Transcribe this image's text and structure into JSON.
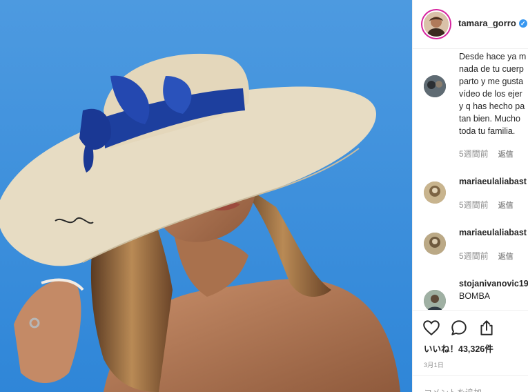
{
  "post": {
    "username": "tamara_gorro",
    "verified_icon": "verified-check-icon",
    "likes_text": "いいね！43,326件",
    "date": "3月1日",
    "add_comment_placeholder": "コメントを追加..."
  },
  "comments": [
    {
      "avatar_color": "#3b4650",
      "lines": [
        "Desde hace ya m",
        "nada de tu cuerp",
        "parto y me gusta",
        "vídeo de los ejer",
        "y q has hecho pa",
        "tan bien. Mucho",
        "toda tu familia."
      ],
      "time": "5週間前",
      "reply": "返信"
    },
    {
      "avatar_color": "#a8906a",
      "username": "mariaeulaliabast",
      "time": "5週間前",
      "reply": "返信"
    },
    {
      "avatar_color": "#9a8a66",
      "username": "mariaeulaliabast",
      "time": "5週間前",
      "reply": "返信"
    },
    {
      "avatar_color": "#6e7b70",
      "username": "stojanivanovic19",
      "text": "BOMBA"
    }
  ],
  "colors": {
    "sky": "#3d8fd8",
    "hat": "#e7dcc3",
    "ribbon": "#1d3f9e",
    "verified": "#3897f0",
    "meta_text": "#8e8e8e"
  },
  "icons": [
    "heart-icon",
    "comment-icon",
    "share-icon"
  ]
}
